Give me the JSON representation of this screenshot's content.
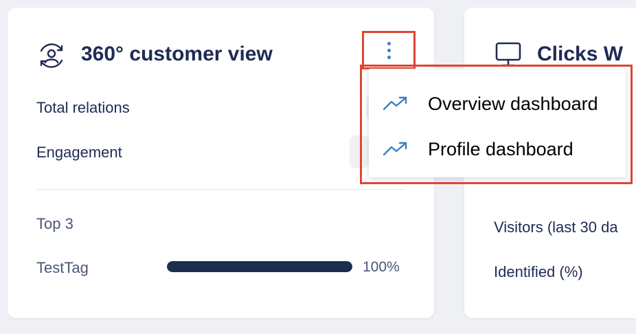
{
  "left_card": {
    "title": "360° customer view",
    "title_icon": "user-refresh-icon",
    "menu_icon": "kebab-menu-icon",
    "rows": {
      "total_relations": "Total relations",
      "engagement": "Engagement"
    },
    "top_section": {
      "heading": "Top 3",
      "items": [
        {
          "label": "TestTag",
          "value": 1.0,
          "percent_text": "100%"
        }
      ]
    }
  },
  "right_card": {
    "title": "Clicks W",
    "title_icon": "monitor-icon",
    "rows": {
      "visitors": "Visitors (last 30 da",
      "identified": "Identified (%)"
    }
  },
  "dropdown_menu": {
    "items": [
      {
        "label": "Overview dashboard",
        "icon": "trending-up-icon"
      },
      {
        "label": "Profile dashboard",
        "icon": "trending-up-icon"
      }
    ]
  },
  "colors": {
    "accent": "#3a7fc4",
    "text": "#1f2a55",
    "progress": "#1b2f4d",
    "highlight_box": "#e0452f"
  }
}
